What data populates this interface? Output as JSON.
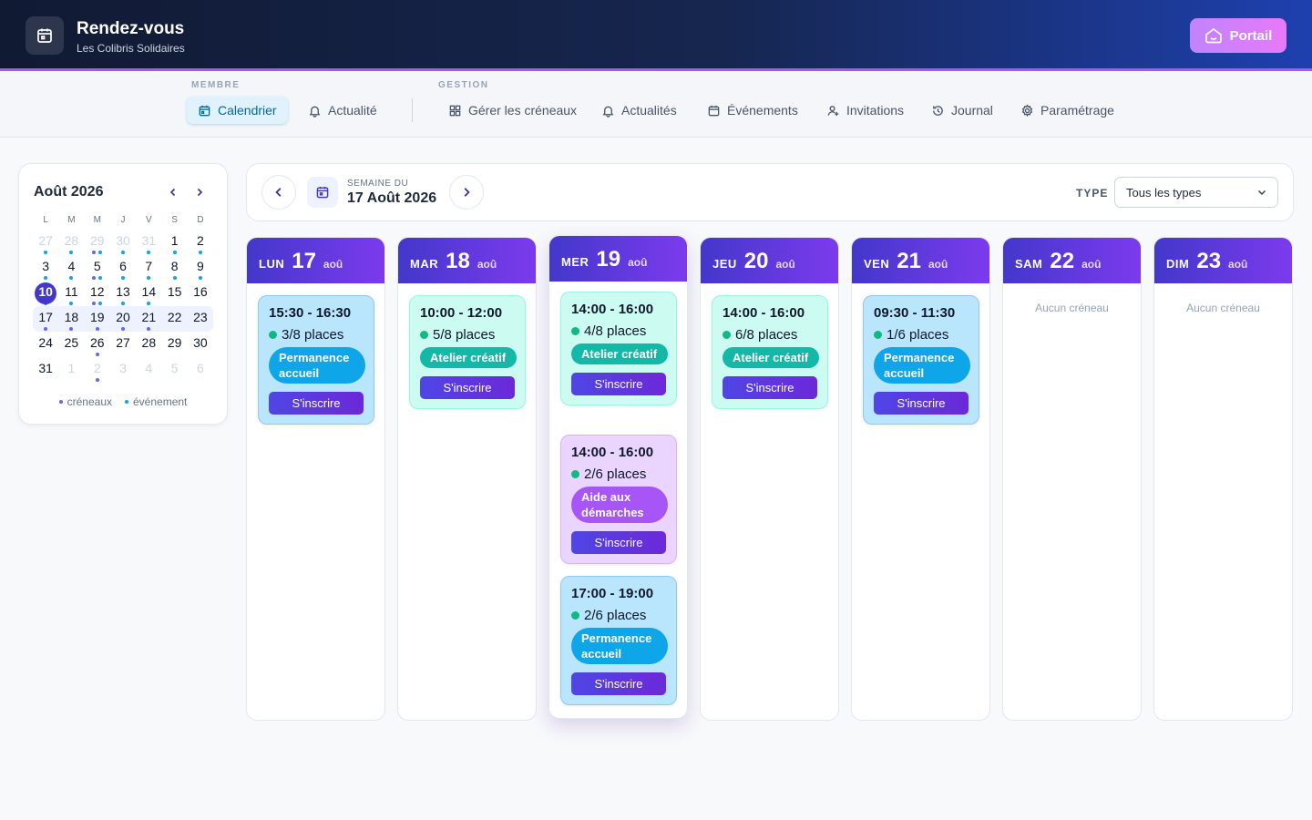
{
  "header": {
    "title": "Rendez-vous",
    "subtitle": "Les Colibris Solidaires",
    "portal_label": "Portail"
  },
  "nav": {
    "member_label": "MEMBRE",
    "gestion_label": "GESTION",
    "items": [
      {
        "label": "Calendrier",
        "icon": "calendar-grid-icon",
        "active": true
      },
      {
        "label": "Actualité",
        "icon": "bell-icon"
      },
      {
        "label": "Gérer les créneaux",
        "icon": "grid-icon"
      },
      {
        "label": "Actualités",
        "icon": "bell-icon"
      },
      {
        "label": "Événements",
        "icon": "calendar-icon"
      },
      {
        "label": "Invitations",
        "icon": "user-plus-icon"
      },
      {
        "label": "Journal",
        "icon": "history-icon"
      },
      {
        "label": "Paramétrage",
        "icon": "gear-icon"
      }
    ]
  },
  "mini_calendar": {
    "title": "Août 2026",
    "weekdays": [
      "L",
      "M",
      "M",
      "J",
      "V",
      "S",
      "D"
    ],
    "legend": {
      "slots": "créneaux",
      "events": "événement"
    },
    "weeks": [
      [
        {
          "d": "27",
          "o": true,
          "dots": [
            "event"
          ]
        },
        {
          "d": "28",
          "o": true,
          "dots": [
            "event"
          ]
        },
        {
          "d": "29",
          "o": true,
          "dots": [
            "slot",
            "event"
          ]
        },
        {
          "d": "30",
          "o": true,
          "dots": [
            "event"
          ]
        },
        {
          "d": "31",
          "o": true,
          "dots": [
            "event"
          ]
        },
        {
          "d": "1",
          "dots": [
            "event"
          ]
        },
        {
          "d": "2",
          "dots": [
            "event"
          ]
        }
      ],
      [
        {
          "d": "3",
          "dots": [
            "event"
          ]
        },
        {
          "d": "4",
          "dots": [
            "event"
          ]
        },
        {
          "d": "5",
          "dots": [
            "slot",
            "event"
          ]
        },
        {
          "d": "6",
          "dots": [
            "event"
          ]
        },
        {
          "d": "7",
          "dots": [
            "event"
          ]
        },
        {
          "d": "8",
          "dots": [
            "event"
          ]
        },
        {
          "d": "9",
          "dots": [
            "event"
          ]
        }
      ],
      [
        {
          "d": "10",
          "today": true,
          "dots": [
            "event"
          ]
        },
        {
          "d": "11",
          "dots": [
            "event"
          ]
        },
        {
          "d": "12",
          "dots": [
            "slot",
            "event"
          ]
        },
        {
          "d": "13",
          "dots": [
            "event"
          ]
        },
        {
          "d": "14",
          "dots": [
            "event"
          ]
        },
        {
          "d": "15",
          "dots": []
        },
        {
          "d": "16",
          "dots": []
        }
      ],
      [
        {
          "d": "17",
          "week": true,
          "dots": [
            "slot"
          ]
        },
        {
          "d": "18",
          "week": true,
          "dots": [
            "slot"
          ]
        },
        {
          "d": "19",
          "week": true,
          "dots": [
            "slot"
          ]
        },
        {
          "d": "20",
          "week": true,
          "dots": [
            "slot"
          ]
        },
        {
          "d": "21",
          "week": true,
          "dots": [
            "slot"
          ]
        },
        {
          "d": "22",
          "week": true,
          "dots": []
        },
        {
          "d": "23",
          "week": true,
          "dots": []
        }
      ],
      [
        {
          "d": "24",
          "dots": []
        },
        {
          "d": "25",
          "dots": []
        },
        {
          "d": "26",
          "dots": [
            "slot"
          ]
        },
        {
          "d": "27",
          "dots": []
        },
        {
          "d": "28",
          "dots": []
        },
        {
          "d": "29",
          "dots": []
        },
        {
          "d": "30",
          "dots": []
        }
      ],
      [
        {
          "d": "31",
          "dots": []
        },
        {
          "d": "1",
          "o": true,
          "dots": []
        },
        {
          "d": "2",
          "o": true,
          "dots": [
            "slot"
          ]
        },
        {
          "d": "3",
          "o": true,
          "dots": []
        },
        {
          "d": "4",
          "o": true,
          "dots": []
        },
        {
          "d": "5",
          "o": true,
          "dots": []
        },
        {
          "d": "6",
          "o": true,
          "dots": []
        }
      ]
    ]
  },
  "week": {
    "label": "SEMAINE DU",
    "date": "17 Août 2026",
    "type_label": "TYPE",
    "type_value": "Tous les types"
  },
  "days": [
    {
      "dow": "LUN",
      "num": "17",
      "mon": "aoû",
      "current": false,
      "slots": [
        {
          "time": "15:30 - 16:30",
          "places": "3/8 places",
          "tag": "Permanence accueil",
          "kind": "perm",
          "button": "S'inscrire"
        }
      ]
    },
    {
      "dow": "MAR",
      "num": "18",
      "mon": "aoû",
      "current": false,
      "slots": [
        {
          "time": "10:00 - 12:00",
          "places": "5/8 places",
          "tag": "Atelier créatif",
          "kind": "atel",
          "button": "S'inscrire"
        }
      ]
    },
    {
      "dow": "MER",
      "num": "19",
      "mon": "aoû",
      "current": true,
      "slots": [
        {
          "time": "14:00 - 16:00",
          "places": "4/8 places",
          "tag": "Atelier créatif",
          "kind": "atel",
          "button": "S'inscrire"
        },
        {
          "time": "14:00 - 16:00",
          "places": "2/6 places",
          "tag": "Aide aux démarches",
          "kind": "aide",
          "button": "S'inscrire"
        },
        {
          "time": "17:00 - 19:00",
          "places": "2/6 places",
          "tag": "Permanence accueil",
          "kind": "perm",
          "button": "S'inscrire"
        }
      ]
    },
    {
      "dow": "JEU",
      "num": "20",
      "mon": "aoû",
      "current": false,
      "slots": [
        {
          "time": "14:00 - 16:00",
          "places": "6/8 places",
          "tag": "Atelier créatif",
          "kind": "atel",
          "button": "S'inscrire"
        }
      ]
    },
    {
      "dow": "VEN",
      "num": "21",
      "mon": "aoû",
      "current": false,
      "slots": [
        {
          "time": "09:30 - 11:30",
          "places": "1/6 places",
          "tag": "Permanence accueil",
          "kind": "perm",
          "button": "S'inscrire"
        }
      ]
    },
    {
      "dow": "SAM",
      "num": "22",
      "mon": "aoû",
      "current": false,
      "empty": "Aucun créneau",
      "slots": []
    },
    {
      "dow": "DIM",
      "num": "23",
      "mon": "aoû",
      "current": false,
      "empty": "Aucun créneau",
      "slots": []
    }
  ]
}
